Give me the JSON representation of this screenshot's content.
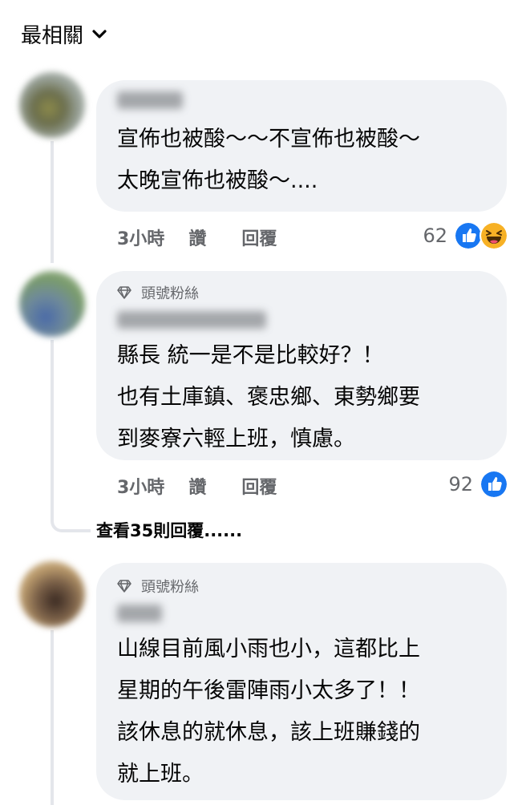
{
  "sort": {
    "label": "最相關"
  },
  "comments": [
    {
      "badge": "",
      "lines": [
        "宣佈也被酸～～不宣佈也被酸～",
        "太晚宣佈也被酸～...."
      ],
      "time": "3小時",
      "like_label": "讚",
      "reply_label": "回覆",
      "reaction_count": "62",
      "reactions": [
        "like-icon",
        "haha-icon"
      ]
    },
    {
      "badge": "頭號粉絲",
      "lines": [
        "縣長 統一是不是比較好？！",
        "也有土庫鎮、褒忠鄉、東勢鄉要",
        "到麥寮六輕上班，慎慮。"
      ],
      "time": "3小時",
      "like_label": "讚",
      "reply_label": "回覆",
      "reaction_count": "92",
      "reactions": [
        "like-icon"
      ],
      "view_replies": "查看35則回覆......"
    },
    {
      "badge": "頭號粉絲",
      "lines": [
        "山線目前風小雨也小，這都比上",
        "星期的午後雷陣雨小太多了！！",
        "該休息的就休息，該上班賺錢的",
        "就上班。"
      ]
    }
  ],
  "colors": {
    "like": "#1877f2",
    "haha": "#f7b125",
    "bubble": "#f0f2f5",
    "meta": "#65676b"
  }
}
